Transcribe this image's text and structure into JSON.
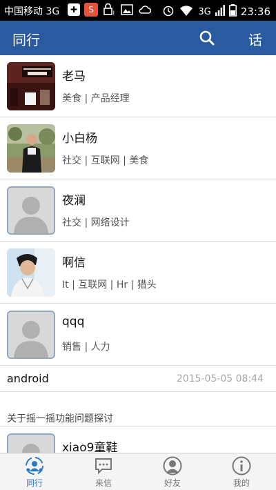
{
  "status_bar": {
    "carrier": "中国移动 3G",
    "network": "3G",
    "time": "23:36",
    "icons": [
      "usb-icon",
      "sogou-icon",
      "lock-warning-icon",
      "image-icon",
      "sync-icon",
      "alarm-icon",
      "wifi-icon",
      "signal-icon",
      "battery-icon"
    ]
  },
  "header": {
    "title": "同行",
    "talk_label": "话",
    "accent": "#2a5a9f"
  },
  "contacts": [
    {
      "name": "老马",
      "tags": "美食 | 产品经理",
      "avatar": "photo-office"
    },
    {
      "name": "小白杨",
      "tags": "社交 | 互联网 | 美食",
      "avatar": "photo-person"
    },
    {
      "name": "夜澜",
      "tags": "社交 | 网络设计",
      "avatar": "default"
    },
    {
      "name": "啊信",
      "tags": "It | 互联网 | Hr | 猎头",
      "avatar": "photo-portrait"
    },
    {
      "name": "qqq",
      "tags": "销售 | 人力",
      "avatar": "default"
    }
  ],
  "post": {
    "title": "android",
    "date": "2015-05-05 08:44"
  },
  "section_title": "关于摇一摇功能问题探讨",
  "partial_contact": {
    "name": "xiao9童鞋",
    "avatar": "default"
  },
  "tabs": [
    {
      "label": "同行",
      "icon": "colleagues-icon",
      "active": true
    },
    {
      "label": "来信",
      "icon": "message-icon",
      "active": false
    },
    {
      "label": "好友",
      "icon": "friends-icon",
      "active": false
    },
    {
      "label": "我的",
      "icon": "info-icon",
      "active": false
    }
  ]
}
